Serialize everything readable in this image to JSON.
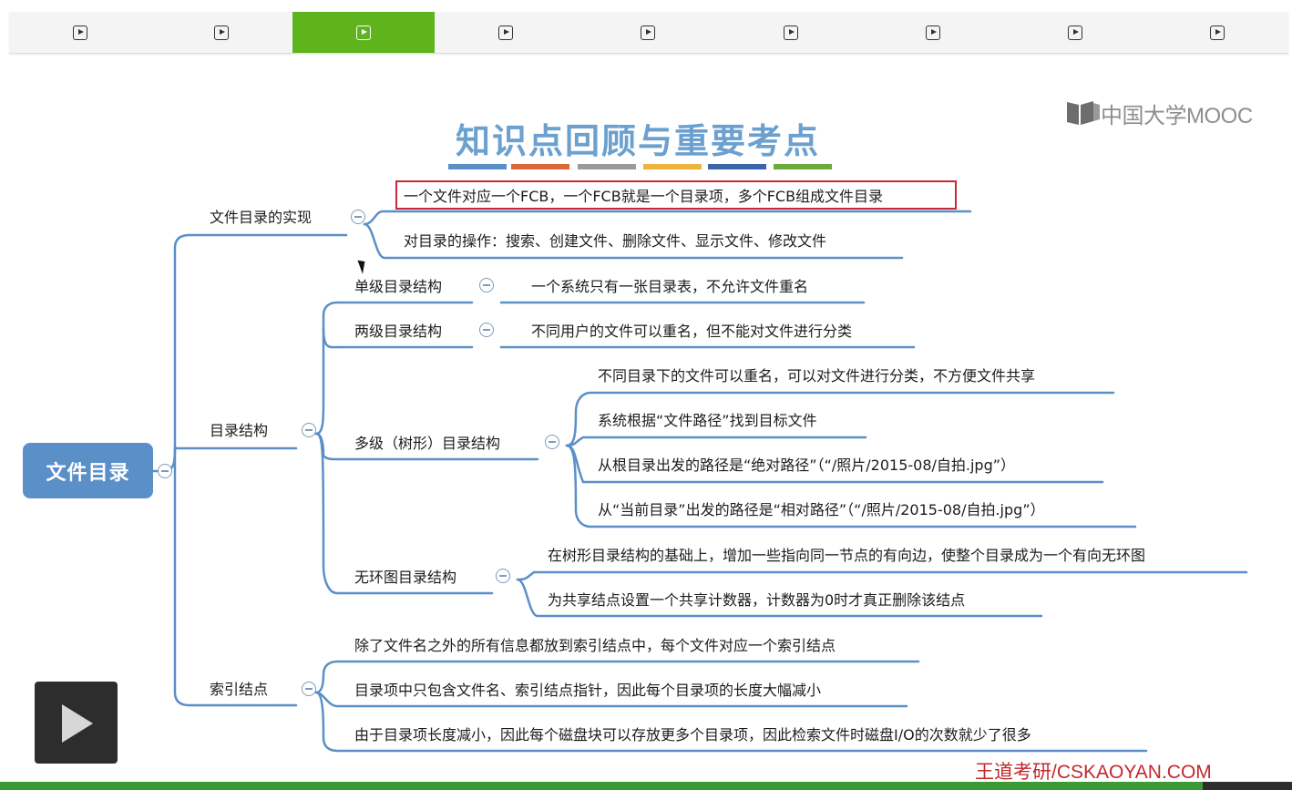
{
  "player": {
    "tabs": [
      {
        "icon": "play-icon",
        "active": false
      },
      {
        "icon": "play-icon",
        "active": false
      },
      {
        "icon": "play-icon",
        "active": true
      },
      {
        "icon": "play-icon",
        "active": false
      },
      {
        "icon": "play-icon",
        "active": false
      },
      {
        "icon": "play-icon",
        "active": false
      },
      {
        "icon": "play-icon",
        "active": false
      },
      {
        "icon": "play-icon",
        "active": false
      },
      {
        "icon": "play-icon",
        "active": false
      }
    ],
    "active_color": "#5fb41e",
    "overlay_icon": "play-icon"
  },
  "slide": {
    "title": "知识点回顾与重要考点",
    "title_bar_colors": [
      "#5b8fc7",
      "#d9683a",
      "#9a9a9a",
      "#edb33b",
      "#3c64a8",
      "#6aab3b"
    ],
    "logo_text": "中国大学MOOC",
    "watermark": "王道考研/CSKAOYAN.COM"
  },
  "mindmap": {
    "root": "文件目录",
    "branches": {
      "impl": {
        "label": "文件目录的实现",
        "items": [
          "一个文件对应一个FCB，一个FCB就是一个目录项，多个FCB组成文件目录",
          "对目录的操作：搜索、创建文件、删除文件、显示文件、修改文件"
        ]
      },
      "structure": {
        "label": "目录结构",
        "single": {
          "label": "单级目录结构",
          "desc": "一个系统只有一张目录表，不允许文件重名"
        },
        "two": {
          "label": "两级目录结构",
          "desc": "不同用户的文件可以重名，但不能对文件进行分类"
        },
        "multi": {
          "label": "多级（树形）目录结构",
          "items": [
            "不同目录下的文件可以重名，可以对文件进行分类，不方便文件共享",
            "系统根据“文件路径”找到目标文件",
            "从根目录出发的路径是“绝对路径”（“/照片/2015-08/自拍.jpg”）",
            "从“当前目录”出发的路径是“相对路径”（“/照片/2015-08/自拍.jpg”）"
          ]
        },
        "acyclic": {
          "label": "无环图目录结构",
          "items": [
            "在树形目录结构的基础上，增加一些指向同一节点的有向边，使整个目录成为一个有向无环图",
            "为共享结点设置一个共享计数器，计数器为0时才真正删除该结点"
          ]
        }
      },
      "index": {
        "label": "索引结点",
        "items": [
          "除了文件名之外的所有信息都放到索引结点中，每个文件对应一个索引结点",
          "目录项中只包含文件名、索引结点指针，因此每个目录项的长度大幅减小",
          "由于目录项长度减小，因此每个磁盘块可以存放更多个目录项，因此检索文件时磁盘I/O的次数就少了很多"
        ]
      }
    },
    "line_color": "#5b8fc7",
    "highlight_color": "#c8283a"
  }
}
